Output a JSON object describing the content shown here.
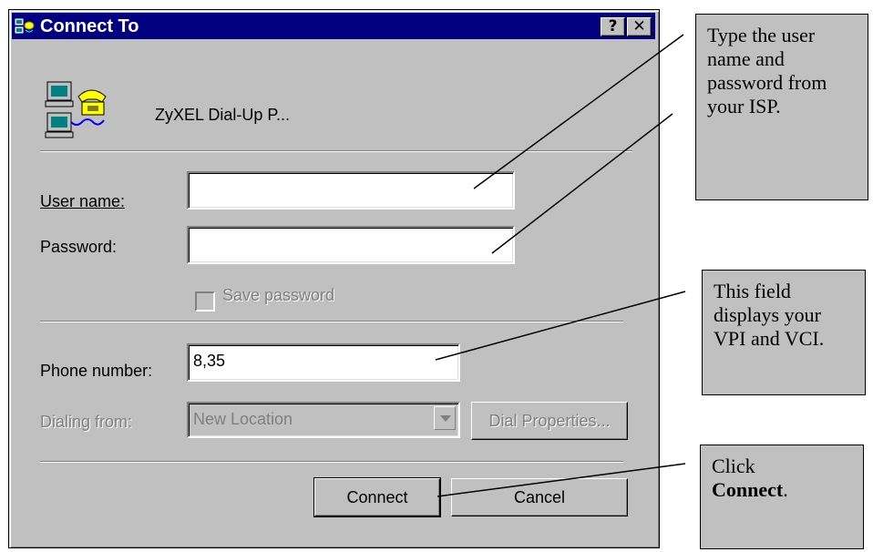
{
  "dialog": {
    "title": "Connect To",
    "help_button": "?",
    "close_button": "✕",
    "connection_name": "ZyXEL Dial-Up P...",
    "user_name_label": "User name:",
    "user_name_value": "",
    "password_label": "Password:",
    "password_value": "",
    "save_password_label": "Save password",
    "save_password_checked": false,
    "phone_number_label": "Phone number:",
    "phone_number_value": "8,35",
    "dialing_from_label": "Dialing from:",
    "dialing_from_value": "New Location",
    "dial_properties_button": "Dial Properties...",
    "connect_button": "Connect",
    "cancel_button": "Cancel"
  },
  "callouts": {
    "credentials": "Type the user name and password from your ISP.",
    "phone": "This field displays your VPI and VCI.",
    "connect_prefix": "Click",
    "connect_bold": "Connect",
    "connect_suffix": "."
  },
  "icons": {
    "title": "dial-up-connection-icon",
    "connection": "computers-phone-icon",
    "dropdown": "chevron-down-icon"
  },
  "colors": {
    "titlebar": "#000080",
    "dialog_face": "#c0c0c0",
    "callout_face": "#c0c0c0",
    "disabled_text": "#808080"
  }
}
